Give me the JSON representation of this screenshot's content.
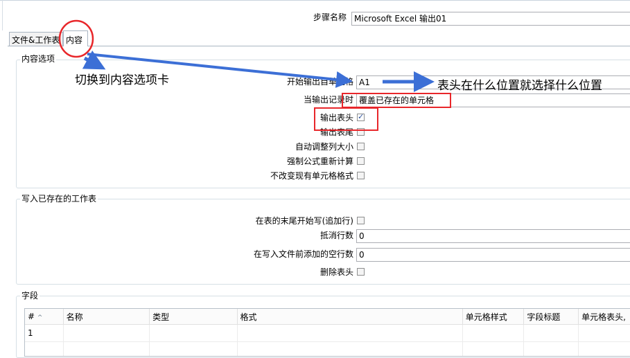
{
  "step": {
    "label": "步骤名称",
    "value": "Microsoft Excel 输出01"
  },
  "tabs": [
    {
      "label": "文件&工作表"
    },
    {
      "label": "内容"
    }
  ],
  "content_group": {
    "title": "内容选项",
    "start_cell": {
      "label": "开始输出自单元格",
      "value": "A1"
    },
    "on_output": {
      "label": "当输出记录时",
      "value": "覆盖已存在的单元格"
    },
    "checkboxes": [
      {
        "label": "输出表头",
        "checked": true
      },
      {
        "label": "输出表尾",
        "checked": false
      },
      {
        "label": "自动调整列大小",
        "checked": false
      },
      {
        "label": "强制公式重新计算",
        "checked": false
      },
      {
        "label": "不改变现有单元格格式",
        "checked": false
      }
    ]
  },
  "existing_group": {
    "title": "写入已存在的工作表",
    "append": {
      "label": "在表的末尾开始写(追加行)",
      "checked": false
    },
    "offset": {
      "label": "抵消行数",
      "value": "0"
    },
    "blank_lines": {
      "label": "在写入文件前添加的空行数",
      "value": "0"
    },
    "remove_header": {
      "label": "删除表头",
      "checked": false
    }
  },
  "fields_group": {
    "title": "字段",
    "columns": [
      "#",
      "名称",
      "类型",
      "格式",
      "单元格样式",
      "字段标题",
      "单元格表头,"
    ],
    "rows": [
      [
        "1",
        "",
        "",
        "",
        "",
        "",
        ""
      ]
    ]
  },
  "annotations": {
    "switch_tab": "切换到内容选项卡",
    "header_position": "表头在什么位置就选择什么位置"
  },
  "colors": {
    "annotation_red": "#e8262a",
    "arrow_blue": "#3c6fd6",
    "checkbox_check": "#2a4f9c"
  }
}
